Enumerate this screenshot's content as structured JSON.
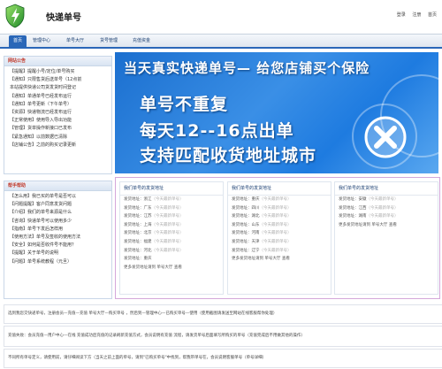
{
  "header": {
    "site_title": "快递单号",
    "top_links": [
      "登录",
      "注册",
      "首页"
    ]
  },
  "nav": {
    "items": [
      "首页",
      "管理中心",
      "单号大厅",
      "货号管理",
      "充值资金"
    ]
  },
  "sidebar_notice": {
    "title": "网站公告",
    "items": [
      "【提醒】提醒小号/定位/单号购买",
      "【通知】只限售货后送单号（12点前",
      "本站提供快递公司货发货时间登记",
      "【通知】单通单号已经发布运行",
      "【通知】单号更新（下午单号）",
      "【资源】快递物流已经发布运行",
      "【正常使用】使用导入导出功能",
      "【管理】货单操作新接口已发布",
      "【紧急通知】以前数据已清除",
      "【店铺公告】之前的购买记录更新"
    ]
  },
  "sidebar_help": {
    "title": "帮手帮助",
    "items": [
      "【怎么用】我已买的单号是否可以",
      "【问题提醒】客户同意发货问题",
      "【介绍】我们的单号来源是什么",
      "【咨询】快递单号可以使用多少",
      "【指南】单号下发后怎样用",
      "【使用方法】单号及签收的使用方法",
      "【安全】如何是否收件号不能用？",
      "【提醒】关于单号的说明",
      "【问题】单号系统教程（元旦）"
    ]
  },
  "banner": {
    "top": "当天真实快递单号— 给您店铺买个保险",
    "lines": [
      "单号不重复",
      "每天12--16点出单",
      "支持匹配收货地址城市"
    ]
  },
  "address_panel": {
    "columns": [
      {
        "title": "我们单号的发货地址",
        "rows": [
          {
            "label": "发货地址：浙江",
            "hint": "（今天最新单号）"
          },
          {
            "label": "发货地址：广东",
            "hint": "（今天最新单号）"
          },
          {
            "label": "发货地址：江苏",
            "hint": "（今天最新单号）"
          },
          {
            "label": "发货地址：上海",
            "hint": "（今天最新单号）"
          },
          {
            "label": "发货地址：北京",
            "hint": "（今天最新单号）"
          },
          {
            "label": "发货地址：福建",
            "hint": "（今天最新单号）"
          },
          {
            "label": "发货地址：河北",
            "hint": "（今天最新单号）"
          },
          {
            "label": "发货地址：重庆",
            "hint": ""
          },
          {
            "label": "更多发货地址请到  单号大厅  查看",
            "hint": ""
          }
        ]
      },
      {
        "title": "我们单号的发货地址",
        "rows": [
          {
            "label": "发货地址：重庆",
            "hint": "（今天最新单号）"
          },
          {
            "label": "发货地址：四川",
            "hint": "（今天最新单号）"
          },
          {
            "label": "发货地址：湖北",
            "hint": "（今天最新单号）"
          },
          {
            "label": "发货地址：山东",
            "hint": "（今天最新单号）"
          },
          {
            "label": "发货地址：河南",
            "hint": "（今天最新单号）"
          },
          {
            "label": "发货地址：天津",
            "hint": "（今天最新单号）"
          },
          {
            "label": "发货地址：辽宁",
            "hint": "（今天最新单号）"
          },
          {
            "label": "更多发货地址请到  单号大厅  查看",
            "hint": ""
          }
        ]
      },
      {
        "title": "我们单号的发货地址",
        "rows": [
          {
            "label": "发货地址：安徽",
            "hint": "（今天最新单号）"
          },
          {
            "label": "发货地址：江西",
            "hint": "（今天最新单号）"
          },
          {
            "label": "发货地址：湖南",
            "hint": "（今天最新单号）"
          },
          {
            "label": "更多发货地址请到  单号大厅  查看",
            "hint": ""
          }
        ]
      }
    ]
  },
  "bottom_rows": [
    "选到我您交快递单号，注册会员—充值—充值 单号大厅—购买单号 ，然后到—管理中心—已购买单号—使用（使用截图请发送至网站在线客服帮你处理）",
    "充值失败：会员充值—用户中心—在线 充值成功后充值的记录刷新充值方式，会员说明有充值 流程，请发货单号后面填写所购买的单号（充值完成后不用做其他的操作）",
    "不同所有单号定义，请使用前，请仔细阅读下方（当天之前上面的单号，请到\"已购买单号\"中找到，帮我带单号在，会员说明客服单号（单号详细）"
  ]
}
